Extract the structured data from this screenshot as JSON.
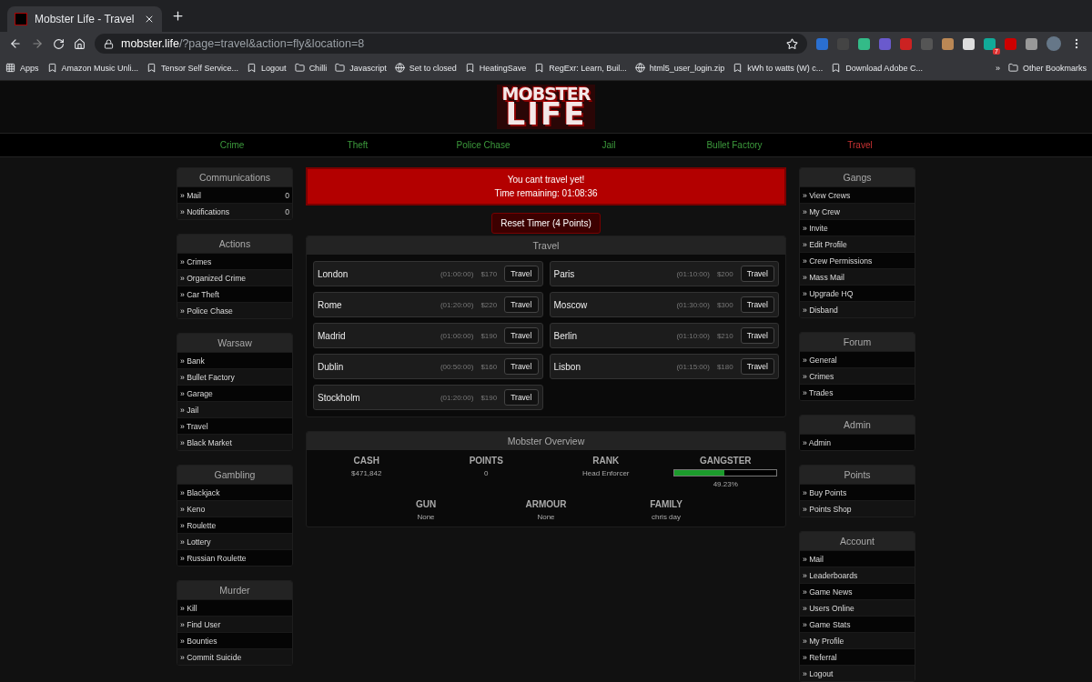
{
  "browser": {
    "tab_title": "Mobster Life - Travel",
    "url_host": "mobster.life",
    "url_path": "/?page=travel&action=fly&location=8",
    "extension_badge": "7",
    "bookmarks": [
      {
        "label": "Apps",
        "kind": "apps"
      },
      {
        "label": "Amazon Music Unli...",
        "kind": "site"
      },
      {
        "label": "Tensor Self Service...",
        "kind": "site"
      },
      {
        "label": "Logout",
        "kind": "site"
      },
      {
        "label": "Chilli",
        "kind": "folder"
      },
      {
        "label": "Javascript",
        "kind": "folder"
      },
      {
        "label": "Set to closed",
        "kind": "globe"
      },
      {
        "label": "HeatingSave",
        "kind": "site"
      },
      {
        "label": "RegExr: Learn, Buil...",
        "kind": "site"
      },
      {
        "label": "html5_user_login.zip",
        "kind": "globe"
      },
      {
        "label": "kWh to watts (W) c...",
        "kind": "site"
      },
      {
        "label": "Download Adobe C...",
        "kind": "site"
      }
    ],
    "overflow": "»",
    "other_bookmarks": "Other Bookmarks"
  },
  "logo": {
    "line_1": "MOBSTER",
    "line_2": "LIFE"
  },
  "nav": [
    {
      "label": "Crime",
      "selected": false
    },
    {
      "label": "Theft",
      "selected": false
    },
    {
      "label": "Police Chase",
      "selected": false
    },
    {
      "label": "Jail",
      "selected": false
    },
    {
      "label": "Bullet Factory",
      "selected": false
    },
    {
      "label": "Travel",
      "selected": true
    }
  ],
  "left_sidebar": [
    {
      "title": "Communications",
      "items": [
        {
          "label": "» Mail",
          "count": "0"
        },
        {
          "label": "» Notifications",
          "count": "0"
        }
      ]
    },
    {
      "title": "Actions",
      "items": [
        {
          "label": "» Crimes"
        },
        {
          "label": "» Organized Crime"
        },
        {
          "label": "» Car Theft"
        },
        {
          "label": "» Police Chase"
        }
      ]
    },
    {
      "title": "Warsaw",
      "items": [
        {
          "label": "» Bank"
        },
        {
          "label": "» Bullet Factory"
        },
        {
          "label": "» Garage"
        },
        {
          "label": "» Jail"
        },
        {
          "label": "» Travel"
        },
        {
          "label": "» Black Market"
        }
      ]
    },
    {
      "title": "Gambling",
      "items": [
        {
          "label": "» Blackjack"
        },
        {
          "label": "» Keno"
        },
        {
          "label": "» Roulette"
        },
        {
          "label": "» Lottery"
        },
        {
          "label": "» Russian Roulette"
        }
      ]
    },
    {
      "title": "Murder",
      "items": [
        {
          "label": "» Kill"
        },
        {
          "label": "» Find User"
        },
        {
          "label": "» Bounties"
        },
        {
          "label": "» Commit Suicide"
        }
      ]
    }
  ],
  "alert": {
    "lines": [
      "You cant travel yet!",
      "Time remaining: 01:08:36"
    ]
  },
  "reset_button": "Reset Timer (4 Points)",
  "travel": {
    "title": "Travel",
    "destinations": [
      {
        "city": "London",
        "time": "(01:00:00)",
        "price": "$170",
        "button": "Travel"
      },
      {
        "city": "Paris",
        "time": "(01:10:00)",
        "price": "$200",
        "button": "Travel"
      },
      {
        "city": "Rome",
        "time": "(01:20:00)",
        "price": "$220",
        "button": "Travel"
      },
      {
        "city": "Moscow",
        "time": "(01:30:00)",
        "price": "$300",
        "button": "Travel"
      },
      {
        "city": "Madrid",
        "time": "(01:00:00)",
        "price": "$190",
        "button": "Travel"
      },
      {
        "city": "Berlin",
        "time": "(01:10:00)",
        "price": "$210",
        "button": "Travel"
      },
      {
        "city": "Dublin",
        "time": "(00:50:00)",
        "price": "$160",
        "button": "Travel"
      },
      {
        "city": "Lisbon",
        "time": "(01:15:00)",
        "price": "$180",
        "button": "Travel"
      },
      {
        "city": "Stockholm",
        "time": "(01:20:00)",
        "price": "$190",
        "button": "Travel"
      }
    ]
  },
  "overview": {
    "title": "Mobster Overview",
    "rows": [
      [
        {
          "label": "CASH",
          "kind": "text",
          "value": "$471,842"
        },
        {
          "label": "POINTS",
          "kind": "text",
          "value": "0"
        },
        {
          "label": "RANK",
          "kind": "text",
          "value": "Head Enforcer"
        },
        {
          "label": "GANGSTER",
          "kind": "progress",
          "level": 0.4923,
          "reading": "49.23%"
        }
      ],
      [
        {
          "label": "GUN",
          "kind": "text",
          "value": "None"
        },
        {
          "label": "ARMOUR",
          "kind": "text",
          "value": "None"
        },
        {
          "label": "FAMILY",
          "kind": "text",
          "value": "chris day"
        }
      ]
    ]
  },
  "right_sidebar": [
    {
      "title": "Gangs",
      "items": [
        {
          "label": "» View Crews"
        },
        {
          "label": "» My Crew"
        },
        {
          "label": "» Invite"
        },
        {
          "label": "» Edit Profile"
        },
        {
          "label": "» Crew Permissions"
        },
        {
          "label": "» Mass Mail"
        },
        {
          "label": "» Upgrade HQ"
        },
        {
          "label": "» Disband"
        }
      ]
    },
    {
      "title": "Forum",
      "items": [
        {
          "label": "» General"
        },
        {
          "label": "» Crimes"
        },
        {
          "label": "» Trades"
        }
      ]
    },
    {
      "title": "Admin",
      "items": [
        {
          "label": "» Admin"
        }
      ]
    },
    {
      "title": "Points",
      "items": [
        {
          "label": "» Buy Points"
        },
        {
          "label": "» Points Shop"
        }
      ]
    },
    {
      "title": "Account",
      "items": [
        {
          "label": "» Mail"
        },
        {
          "label": "» Leaderboards"
        },
        {
          "label": "» Game News"
        },
        {
          "label": "» Users Online"
        },
        {
          "label": "» Game Stats"
        },
        {
          "label": "» My Profile"
        },
        {
          "label": "» Referral"
        },
        {
          "label": "» Logout"
        }
      ]
    }
  ]
}
